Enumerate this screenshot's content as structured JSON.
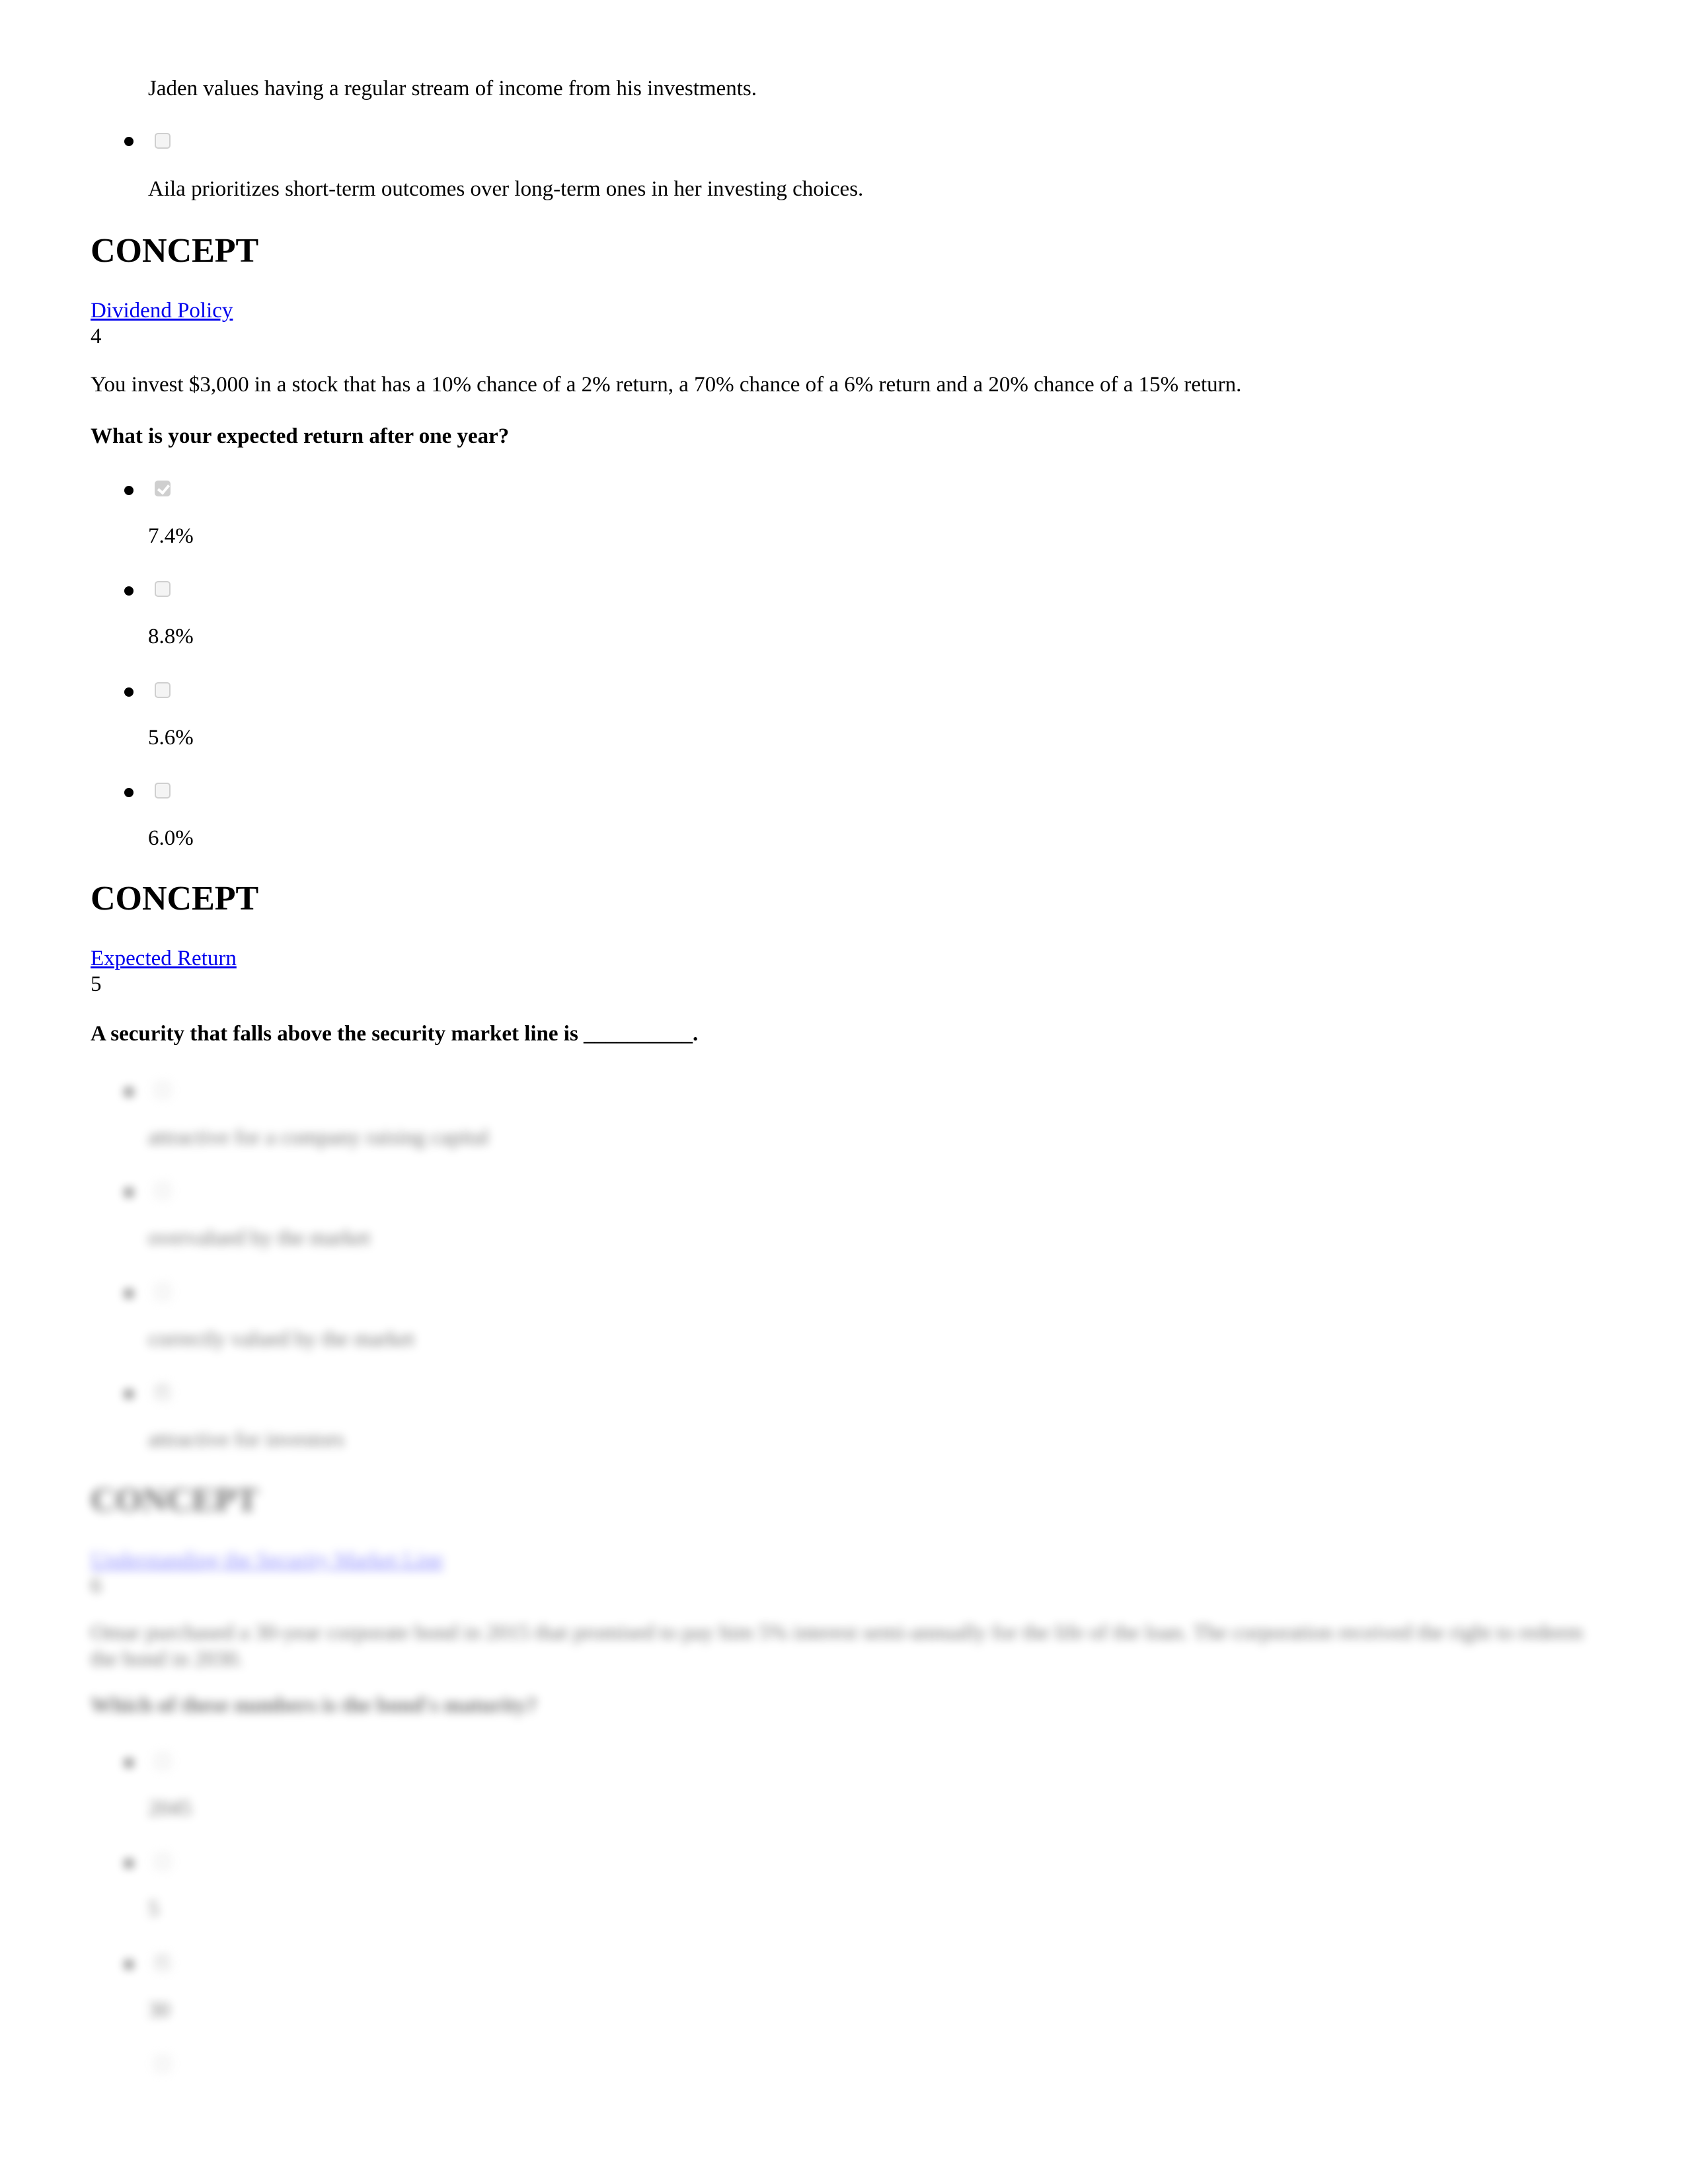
{
  "prev_question": {
    "options": [
      {
        "text": "Jaden values having a regular stream of income from his investments.",
        "checked": false
      },
      {
        "text": "Aila prioritizes short-term outcomes over long-term ones in her investing choices.",
        "checked": false
      }
    ],
    "concept_heading": "CONCEPT",
    "concept_link": "Dividend Policy"
  },
  "q4": {
    "number": "4",
    "prompt": "You invest $3,000 in a stock that has a 10% chance of a 2% return, a 70% chance of a 6% return and a 20% chance of a 15% return.",
    "question": "What is your expected return after one year?",
    "options": [
      {
        "text": "7.4%",
        "checked": true
      },
      {
        "text": "8.8%",
        "checked": false
      },
      {
        "text": "5.6%",
        "checked": false
      },
      {
        "text": "6.0%",
        "checked": false
      }
    ],
    "concept_heading": "CONCEPT",
    "concept_link": "Expected Return"
  },
  "q5": {
    "number": "5",
    "question": "A security that falls above the security market line is __________.",
    "options": [
      {
        "text": "attractive for a company raising capital",
        "checked": false
      },
      {
        "text": "overvalued by the market",
        "checked": false
      },
      {
        "text": "correctly valued by the market",
        "checked": false
      },
      {
        "text": "attractive for investors",
        "checked": true
      }
    ],
    "concept_heading": "CONCEPT",
    "concept_link": "Understanding the Security Market Line"
  },
  "q6": {
    "number": "6",
    "prompt": "Omar purchased a 30-year corporate bond in 2015 that promised to pay him 5% interest semi-annually for the life of the loan. The corporation received the right to redeem the bond in 2030.",
    "question": "Which of these numbers is the bond's maturity?",
    "options": [
      {
        "text": "2045",
        "checked": false
      },
      {
        "text": "5",
        "checked": false
      },
      {
        "text": "30",
        "checked": true
      },
      {
        "text": "",
        "checked": false
      }
    ]
  }
}
